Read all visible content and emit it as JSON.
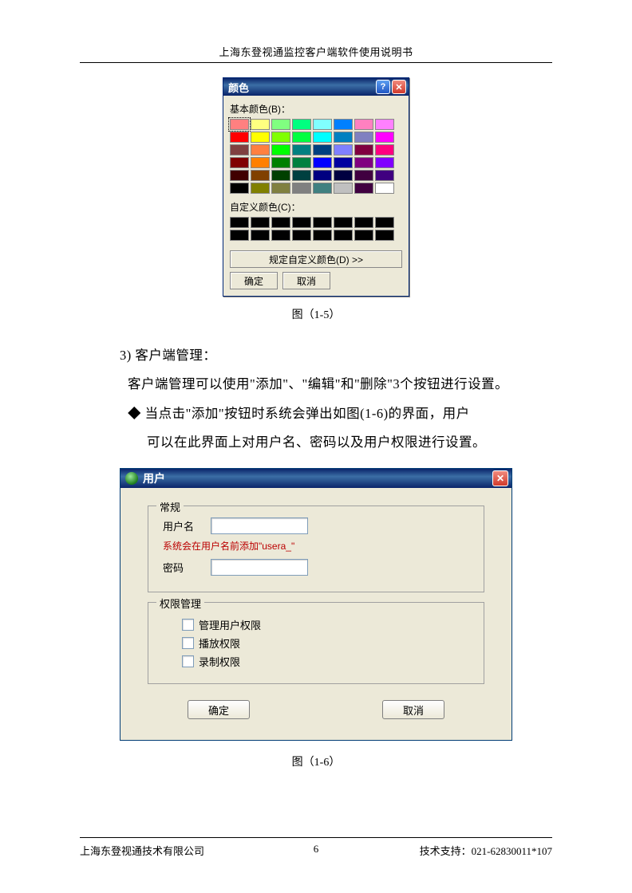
{
  "header": {
    "title": "上海东登视通监控客户端软件使用说明书"
  },
  "colorDialog": {
    "title": "颜色",
    "helpSymbol": "?",
    "closeSymbol": "✕",
    "basicLabel": "基本颜色(B)：",
    "customLabel": "自定义颜色(C)：",
    "defineBtn": "规定自定义颜色(D) >>",
    "okBtn": "确定",
    "cancelBtn": "取消",
    "basicColors": [
      [
        "#ff8080",
        "#ffff80",
        "#80ff80",
        "#00ff80",
        "#80ffff",
        "#0080ff",
        "#ff80c0",
        "#ff80ff"
      ],
      [
        "#ff0000",
        "#ffff00",
        "#80ff00",
        "#00ff40",
        "#00ffff",
        "#0080c0",
        "#8080c0",
        "#ff00ff"
      ],
      [
        "#804040",
        "#ff8040",
        "#00ff00",
        "#008080",
        "#004080",
        "#8080ff",
        "#800040",
        "#ff0080"
      ],
      [
        "#800000",
        "#ff8000",
        "#008000",
        "#008040",
        "#0000ff",
        "#0000a0",
        "#800080",
        "#8000ff"
      ],
      [
        "#400000",
        "#804000",
        "#004000",
        "#004040",
        "#000080",
        "#000040",
        "#400040",
        "#400080"
      ],
      [
        "#000000",
        "#808000",
        "#808040",
        "#808080",
        "#408080",
        "#c0c0c0",
        "#400040",
        "#ffffff"
      ]
    ]
  },
  "captions": {
    "fig15": "图（1-5）",
    "fig16": "图（1-6）"
  },
  "text": {
    "item3": "3) 客户端管理：",
    "p1": "客户端管理可以使用\"添加\"、\"编辑\"和\"删除\"3个按钮进行设置。",
    "bullet1a": "◆ 当点击\"添加\"按钮时系统会弹出如图(1-6)的界面，用户",
    "bullet1b": "可以在此界面上对用户名、密码以及用户权限进行设置。"
  },
  "userDialog": {
    "title": "用户",
    "closeSymbol": "✕",
    "group1": "常规",
    "usernameLabel": "用户名",
    "hint": "系统会在用户名前添加\"usera_\"",
    "passwordLabel": "密码",
    "group2": "权限管理",
    "perm1": "管理用户权限",
    "perm2": "播放权限",
    "perm3": "录制权限",
    "okBtn": "确定",
    "cancelBtn": "取消"
  },
  "footer": {
    "left": "上海东登视通技术有限公司",
    "center": "6",
    "right": "技术支持：021-62830011*107"
  }
}
